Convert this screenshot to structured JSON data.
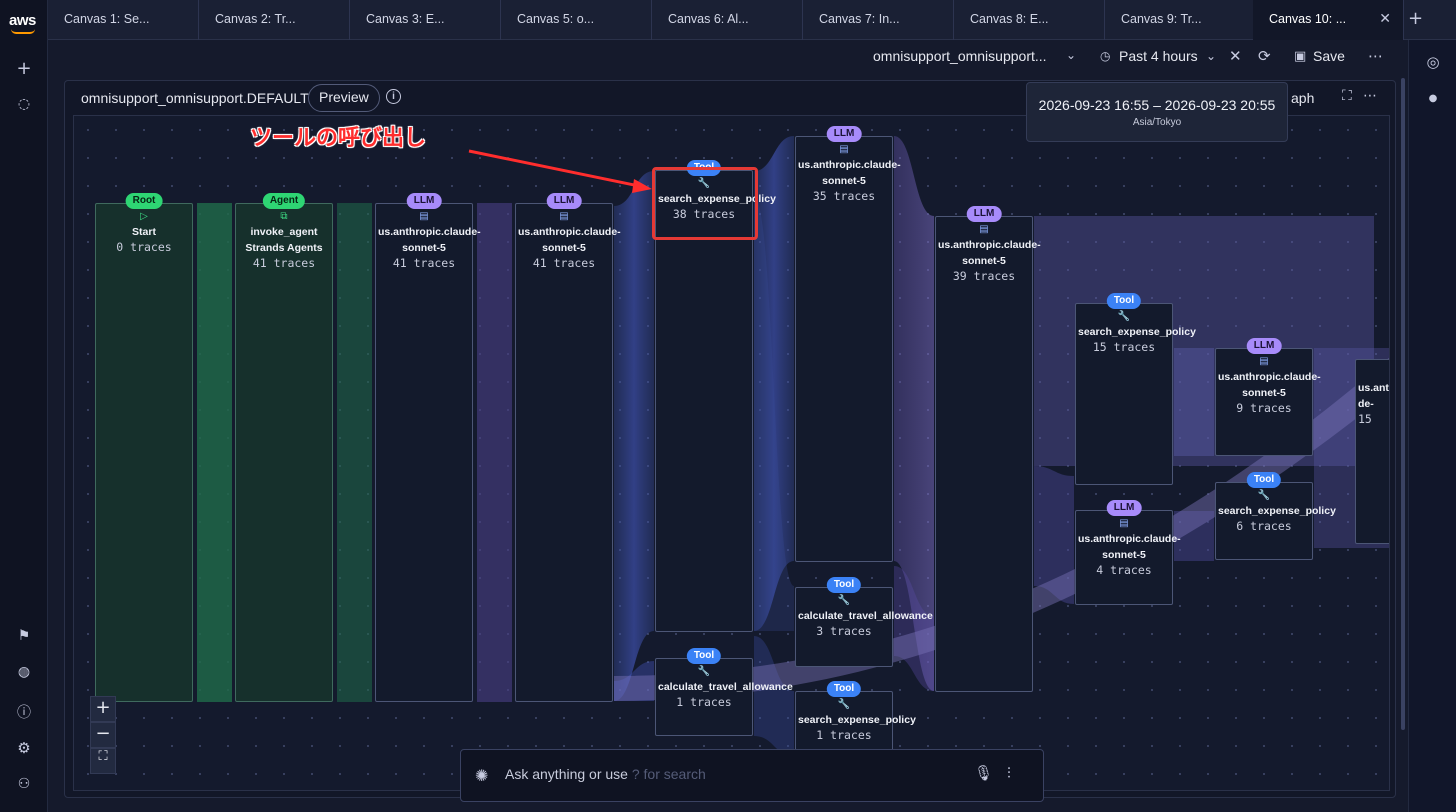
{
  "rail": {
    "logo": "aws",
    "top_icons": [
      "+",
      "💬"
    ],
    "bottom_icons": [
      "🏳",
      "🪐",
      "?",
      "⚙",
      "👤"
    ]
  },
  "tabs": [
    "Canvas 1: Se...",
    "Canvas 2: Tr...",
    "Canvas 3: E...",
    "Canvas 5: o...",
    "Canvas 6: Al...",
    "Canvas 7: In...",
    "Canvas 8: E...",
    "Canvas 9: Tr...",
    "Canvas 10: ..."
  ],
  "active_tab_index": 8,
  "toolbar": {
    "selector": "omnisupport_omnisupport...",
    "time_range": "Past 4 hours",
    "save_label": "Save"
  },
  "popover": {
    "range": "2026-09-23 16:55 – 2026-09-23 20:55",
    "timezone": "Asia/Tokyo"
  },
  "panel": {
    "title": "omnisupport_omnisupport.DEFAULT",
    "preview_label": "Preview",
    "view_label": "aph"
  },
  "annotation": "ツールの呼び出し",
  "nodes": {
    "start": {
      "badge": "Root",
      "name": "Start",
      "traces": "0 traces"
    },
    "agent": {
      "badge": "Agent",
      "name": "invoke_agent Strands Agents",
      "traces": "41 traces"
    },
    "llm1": {
      "badge": "LLM",
      "name": "us.anthropic.claude-sonnet-5",
      "traces": "41 traces"
    },
    "llm2": {
      "badge": "LLM",
      "name": "us.anthropic.claude-sonnet-5",
      "traces": "41 traces"
    },
    "tool1": {
      "badge": "Tool",
      "name": "search_expense_policy",
      "traces": "38 traces"
    },
    "tool2": {
      "badge": "Tool",
      "name": "calculate_travel_allowance",
      "traces": "1 traces"
    },
    "llm3": {
      "badge": "LLM",
      "name": "us.anthropic.claude-sonnet-5",
      "traces": "35 traces"
    },
    "tool3": {
      "badge": "Tool",
      "name": "calculate_travel_allowance",
      "traces": "3 traces"
    },
    "tool4": {
      "badge": "Tool",
      "name": "search_expense_policy",
      "traces": "1 traces"
    },
    "llm4": {
      "badge": "LLM",
      "name": "us.anthropic.claude-sonnet-5",
      "traces": "39 traces"
    },
    "tool5": {
      "badge": "Tool",
      "name": "search_expense_policy",
      "traces": "15 traces"
    },
    "llm5": {
      "badge": "LLM",
      "name": "us.anthropic.claude-sonnet-5",
      "traces": "4 traces"
    },
    "llm6": {
      "badge": "LLM",
      "name": "us.anthropic.claude-sonnet-5",
      "traces": "9 traces"
    },
    "tool6": {
      "badge": "Tool",
      "name": "search_expense_policy",
      "traces": "6 traces"
    },
    "llm7": {
      "badge": "",
      "name": "us.anth de-",
      "traces": "15"
    }
  },
  "zoom": {
    "in": "+",
    "out": "−",
    "fit": "⛶"
  },
  "ask": {
    "placeholder": "Ask anything or use",
    "hint": "? for search"
  },
  "colors": {
    "root": "#2ed573",
    "llm": "#a78bfa",
    "tool": "#3b82f6",
    "highlight": "#e53935"
  }
}
